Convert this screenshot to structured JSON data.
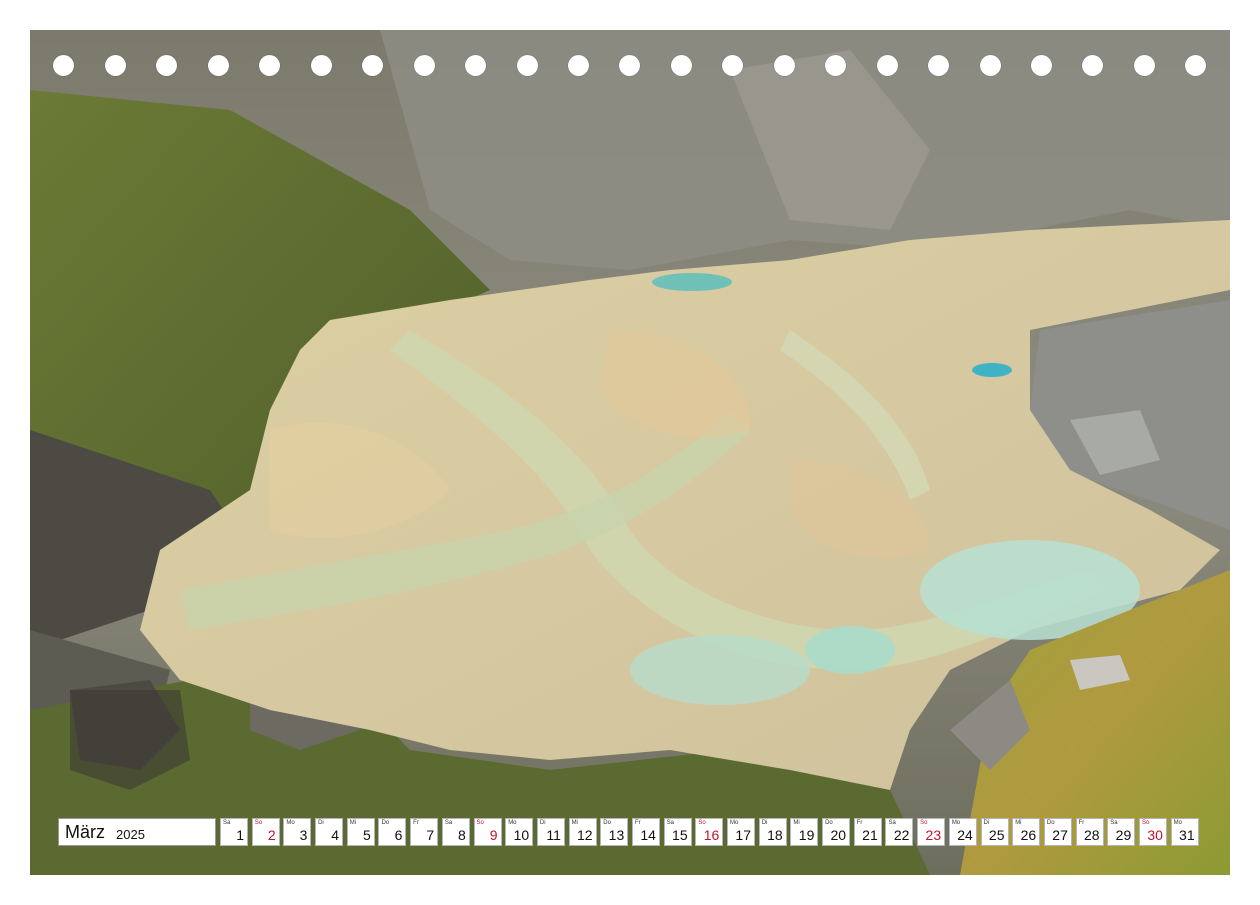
{
  "calendar": {
    "month": "März",
    "year": "2025",
    "days": [
      {
        "wd": "Sa",
        "d": "1",
        "sunday": false
      },
      {
        "wd": "So",
        "d": "2",
        "sunday": true
      },
      {
        "wd": "Mo",
        "d": "3",
        "sunday": false
      },
      {
        "wd": "Di",
        "d": "4",
        "sunday": false
      },
      {
        "wd": "Mi",
        "d": "5",
        "sunday": false
      },
      {
        "wd": "Do",
        "d": "6",
        "sunday": false
      },
      {
        "wd": "Fr",
        "d": "7",
        "sunday": false
      },
      {
        "wd": "Sa",
        "d": "8",
        "sunday": false
      },
      {
        "wd": "So",
        "d": "9",
        "sunday": true
      },
      {
        "wd": "Mo",
        "d": "10",
        "sunday": false
      },
      {
        "wd": "Di",
        "d": "11",
        "sunday": false
      },
      {
        "wd": "Mi",
        "d": "12",
        "sunday": false
      },
      {
        "wd": "Do",
        "d": "13",
        "sunday": false
      },
      {
        "wd": "Fr",
        "d": "14",
        "sunday": false
      },
      {
        "wd": "Sa",
        "d": "15",
        "sunday": false
      },
      {
        "wd": "So",
        "d": "16",
        "sunday": true
      },
      {
        "wd": "Mo",
        "d": "17",
        "sunday": false
      },
      {
        "wd": "Di",
        "d": "18",
        "sunday": false
      },
      {
        "wd": "Mi",
        "d": "19",
        "sunday": false
      },
      {
        "wd": "Do",
        "d": "20",
        "sunday": false
      },
      {
        "wd": "Fr",
        "d": "21",
        "sunday": false
      },
      {
        "wd": "Sa",
        "d": "22",
        "sunday": false
      },
      {
        "wd": "So",
        "d": "23",
        "sunday": true
      },
      {
        "wd": "Mo",
        "d": "24",
        "sunday": false
      },
      {
        "wd": "Di",
        "d": "25",
        "sunday": false
      },
      {
        "wd": "Mi",
        "d": "26",
        "sunday": false
      },
      {
        "wd": "Do",
        "d": "27",
        "sunday": false
      },
      {
        "wd": "Fr",
        "d": "28",
        "sunday": false
      },
      {
        "wd": "Sa",
        "d": "29",
        "sunday": false
      },
      {
        "wd": "So",
        "d": "30",
        "sunday": true
      },
      {
        "wd": "Mo",
        "d": "31",
        "sunday": false
      }
    ]
  },
  "colors": {
    "sunday": "#c8102e",
    "lake": "#d8d0a8",
    "rock": "#8a8a80",
    "grass": "#7a8a3a"
  }
}
